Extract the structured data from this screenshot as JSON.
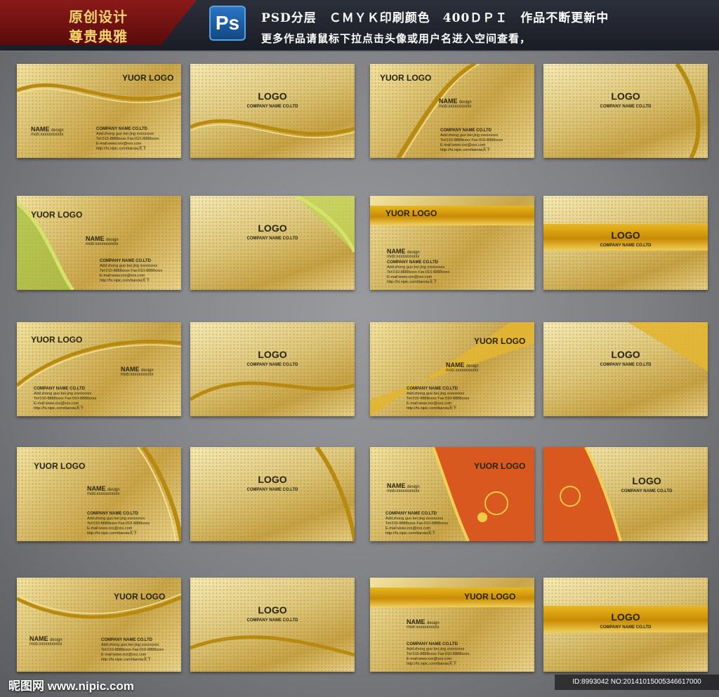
{
  "header": {
    "badge_line1": "原创设计",
    "badge_line2": "尊贵典雅",
    "ps_label": "Ps",
    "headline": "PSD分层　ＣＭＹＫ印刷颜色　400ＤＰＩ　作品不断更新中",
    "subline": "更多作品请鼠标下拉点击头像或用户名进入空间查看，"
  },
  "card_text": {
    "front_logo": "YUOR LOGO",
    "back_logo": "LOGO",
    "back_company": "COMPANY NAME CO.LTD",
    "name": "NAME",
    "name_suffix": "design",
    "mob": "mob:xxxxxxxxxxx",
    "company": "COMPANY NAME CO.LTD",
    "add": "Add:zhong guo bei jing xxxxxxxxx",
    "tel": "Tel:010-8888xxxx Fax:010-8888xxxx",
    "email": "E-mail:www.xxx@xxx.com",
    "web": "http://hi.nipic.com/tianxia天下"
  },
  "footer": {
    "site": "昵图网 www.nipic.com",
    "id": "ID:8993042 NO:20141015005346617000"
  }
}
